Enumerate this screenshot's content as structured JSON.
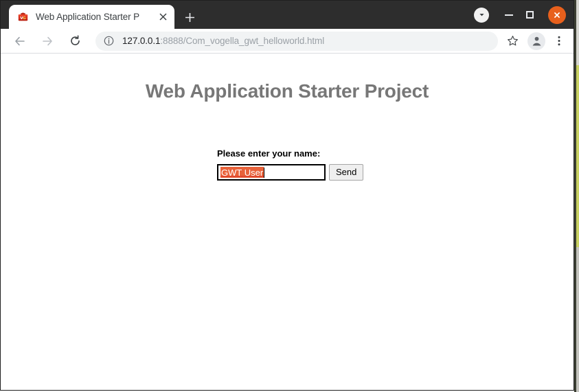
{
  "browser": {
    "tab": {
      "title": "Web Application Starter P",
      "favicon_name": "gwt-toolbox-favicon",
      "close_label": "×"
    },
    "new_tab_label": "+",
    "window_controls": {
      "download_label": "▾",
      "minimize_label": "",
      "maximize_label": "",
      "close_label": "✕"
    },
    "toolbar": {
      "back_label": "←",
      "forward_label": "→",
      "reload_label": "↻",
      "info_label": "i",
      "url_host": "127.0.0.1",
      "url_path": ":8888/Com_vogella_gwt_helloworld.html",
      "url_full": "127.0.0.1:8888/Com_vogella_gwt_helloworld.html",
      "bookmark_label": "☆",
      "menu_label": "⋮"
    }
  },
  "page": {
    "title": "Web Application Starter Project",
    "form": {
      "name_label": "Please enter your name:",
      "name_value": "GWT User",
      "name_placeholder": "",
      "send_label": "Send"
    }
  },
  "colors": {
    "selection_highlight": "#e8623a",
    "window_close": "#e8601c",
    "tab_strip": "#2d2d2d",
    "page_title": "#777777",
    "desktop_green": "#c9d162"
  }
}
